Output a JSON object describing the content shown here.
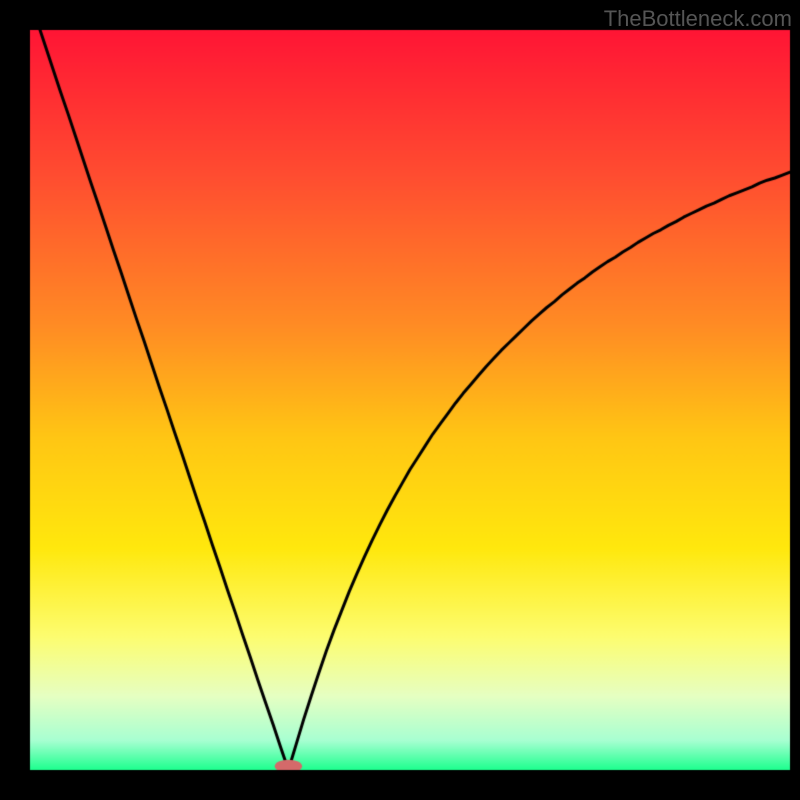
{
  "watermark": "TheBottleneck.com",
  "chart_data": {
    "type": "line",
    "title": "",
    "xlabel": "",
    "ylabel": "",
    "xlim": [
      0,
      100
    ],
    "ylim": [
      0,
      100
    ],
    "notch_x": 34,
    "background_gradient": {
      "type": "vertical",
      "stops": [
        {
          "pos": 0.0,
          "color": "#ff1535"
        },
        {
          "pos": 0.2,
          "color": "#ff4e30"
        },
        {
          "pos": 0.4,
          "color": "#ff8c24"
        },
        {
          "pos": 0.55,
          "color": "#ffc614"
        },
        {
          "pos": 0.7,
          "color": "#ffe80d"
        },
        {
          "pos": 0.82,
          "color": "#fdfd70"
        },
        {
          "pos": 0.9,
          "color": "#e6ffc2"
        },
        {
          "pos": 0.96,
          "color": "#a8ffd2"
        },
        {
          "pos": 1.0,
          "color": "#1dff8e"
        }
      ]
    },
    "marker": {
      "x": 34,
      "y": 0.5,
      "color": "#d46a6a",
      "rx": 1.8,
      "ry": 0.9
    },
    "x": [
      0,
      1,
      2,
      3,
      4,
      5,
      6,
      7,
      8,
      9,
      10,
      11,
      12,
      13,
      14,
      15,
      16,
      17,
      18,
      19,
      20,
      21,
      22,
      23,
      24,
      25,
      26,
      27,
      28,
      29,
      30,
      31,
      32,
      33,
      34,
      35,
      36,
      37,
      38,
      39,
      40,
      41,
      42,
      43,
      44,
      45,
      46,
      47,
      48,
      49,
      50,
      51,
      52,
      53,
      54,
      55,
      56,
      57,
      58,
      59,
      60,
      61,
      62,
      63,
      64,
      65,
      66,
      67,
      68,
      69,
      70,
      71,
      72,
      73,
      74,
      75,
      76,
      77,
      78,
      79,
      80,
      81,
      82,
      83,
      84,
      85,
      86,
      87,
      88,
      89,
      90,
      91,
      92,
      93,
      94,
      95,
      96,
      97,
      98,
      99,
      100
    ],
    "y": [
      104.1,
      101.0,
      97.9,
      94.8,
      91.7,
      88.7,
      85.6,
      82.5,
      79.4,
      76.4,
      73.3,
      70.2,
      67.2,
      64.1,
      61.0,
      58.0,
      54.9,
      51.8,
      48.8,
      45.7,
      42.7,
      39.6,
      36.5,
      33.5,
      30.4,
      27.4,
      24.3,
      21.3,
      18.2,
      15.2,
      12.1,
      9.1,
      6.1,
      3.0,
      0.0,
      3.4,
      6.8,
      10.0,
      13.1,
      16.1,
      18.9,
      21.5,
      24.1,
      26.5,
      28.8,
      31.0,
      33.1,
      35.1,
      37.0,
      38.8,
      40.6,
      42.2,
      43.8,
      45.4,
      46.8,
      48.2,
      49.6,
      50.9,
      52.1,
      53.3,
      54.5,
      55.6,
      56.7,
      57.7,
      58.7,
      59.7,
      60.7,
      61.6,
      62.5,
      63.3,
      64.2,
      65.0,
      65.8,
      66.5,
      67.3,
      68.0,
      68.7,
      69.3,
      70.0,
      70.6,
      71.3,
      71.9,
      72.5,
      73.0,
      73.6,
      74.1,
      74.7,
      75.2,
      75.7,
      76.2,
      76.6,
      77.1,
      77.6,
      78.0,
      78.4,
      78.8,
      79.3,
      79.7,
      80.0,
      80.4,
      80.8
    ]
  }
}
